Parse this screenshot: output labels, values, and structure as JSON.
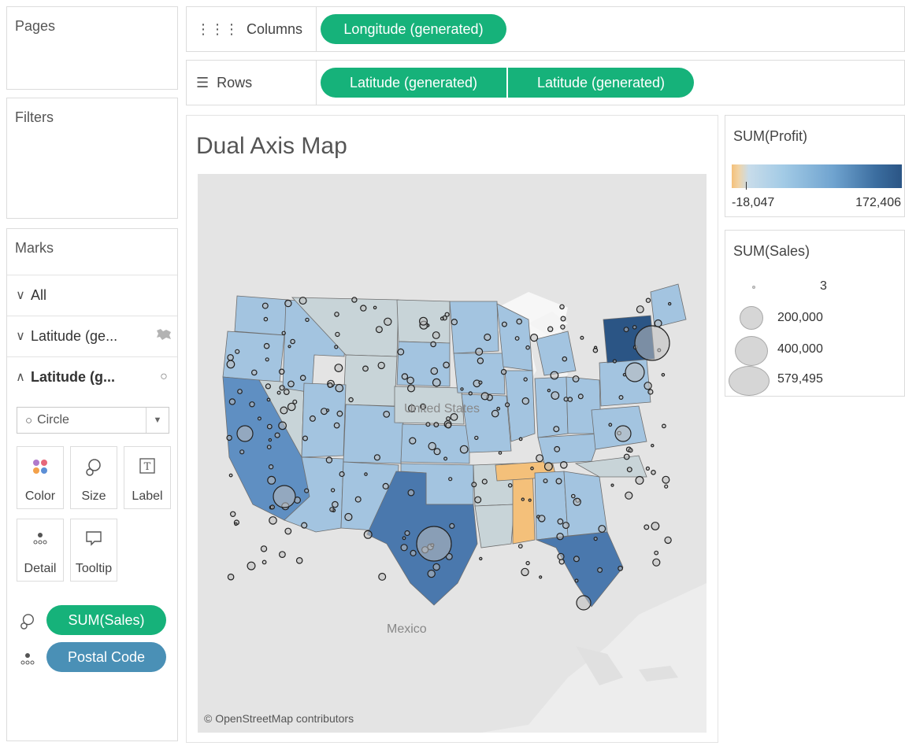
{
  "left_pane": {
    "pages_title": "Pages",
    "filters_title": "Filters",
    "marks_title": "Marks",
    "marks_layers": [
      {
        "label": "All",
        "chevron": "chevron-down-icon"
      },
      {
        "label": "Latitude (ge...",
        "chevron": "chevron-down-icon",
        "icon": "map-icon"
      },
      {
        "label": "Latitude (g...",
        "chevron": "chevron-up-icon",
        "icon": "circle-icon"
      }
    ],
    "mark_type": "Circle",
    "mark_buttons": [
      {
        "label": "Color",
        "icon": "color-dots-icon"
      },
      {
        "label": "Size",
        "icon": "size-icon"
      },
      {
        "label": "Label",
        "icon": "label-icon"
      },
      {
        "label": "Detail",
        "icon": "detail-icon"
      },
      {
        "label": "Tooltip",
        "icon": "tooltip-icon"
      }
    ],
    "mark_pills": [
      {
        "label": "SUM(Sales)",
        "icon": "size-icon",
        "color": "#16b27a"
      },
      {
        "label": "Postal Code",
        "icon": "detail-icon",
        "color": "#4a90b6"
      }
    ]
  },
  "shelves": {
    "columns_label": "Columns",
    "columns_pills": [
      "Longitude (generated)"
    ],
    "rows_label": "Rows",
    "rows_pills": [
      "Latitude (generated)",
      "Latitude (generated)"
    ]
  },
  "view": {
    "title": "Dual Axis Map",
    "map_labels": {
      "country": "United States",
      "mexico": "Mexico"
    },
    "credit": "© OpenStreetMap contributors"
  },
  "legends": {
    "profit": {
      "title": "SUM(Profit)",
      "min": "-18,047",
      "max": "172,406",
      "colors": {
        "low": "#f4c07a",
        "mid": "#a3cbe6",
        "high": "#2b5585"
      }
    },
    "sales": {
      "title": "SUM(Sales)",
      "entries": [
        "3",
        "200,000",
        "400,000",
        "579,495"
      ]
    }
  }
}
